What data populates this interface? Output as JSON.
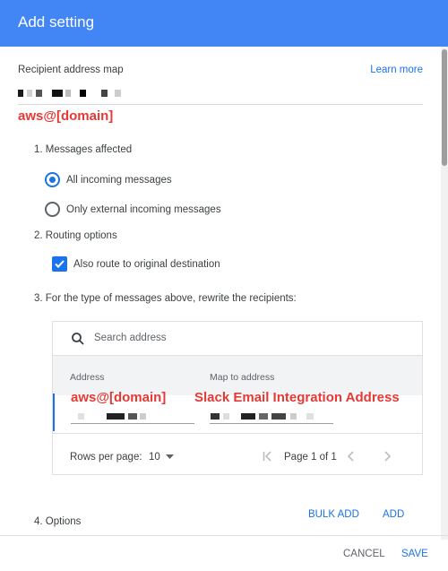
{
  "dialog": {
    "title": "Add setting"
  },
  "section": {
    "title": "Recipient address map",
    "learn_more": "Learn more"
  },
  "annotations": {
    "top": "aws@[domain]",
    "address_col": "aws@[domain]",
    "map_col": "Slack Email Integration Address"
  },
  "steps": {
    "messages_affected": "1. Messages affected",
    "routing_options": "2. Routing options",
    "rewrite": "3. For the type of messages above, rewrite the recipients:",
    "options": "4. Options"
  },
  "radios": {
    "all_incoming": "All incoming messages",
    "only_external": "Only external incoming messages"
  },
  "checkbox": {
    "label": "Also route to original destination"
  },
  "table": {
    "search_placeholder": "Search address",
    "col_address": "Address",
    "col_map": "Map to address",
    "rows_per_page_label": "Rows per page:",
    "rows_per_page_value": "10",
    "page_info": "Page 1 of 1"
  },
  "actions": {
    "bulk_add": "BULK ADD",
    "add": "ADD"
  },
  "footer": {
    "cancel": "CANCEL",
    "save": "SAVE"
  },
  "colors": {
    "accent": "#4285f4",
    "link": "#1a73e8",
    "annotation": "#e53935"
  }
}
